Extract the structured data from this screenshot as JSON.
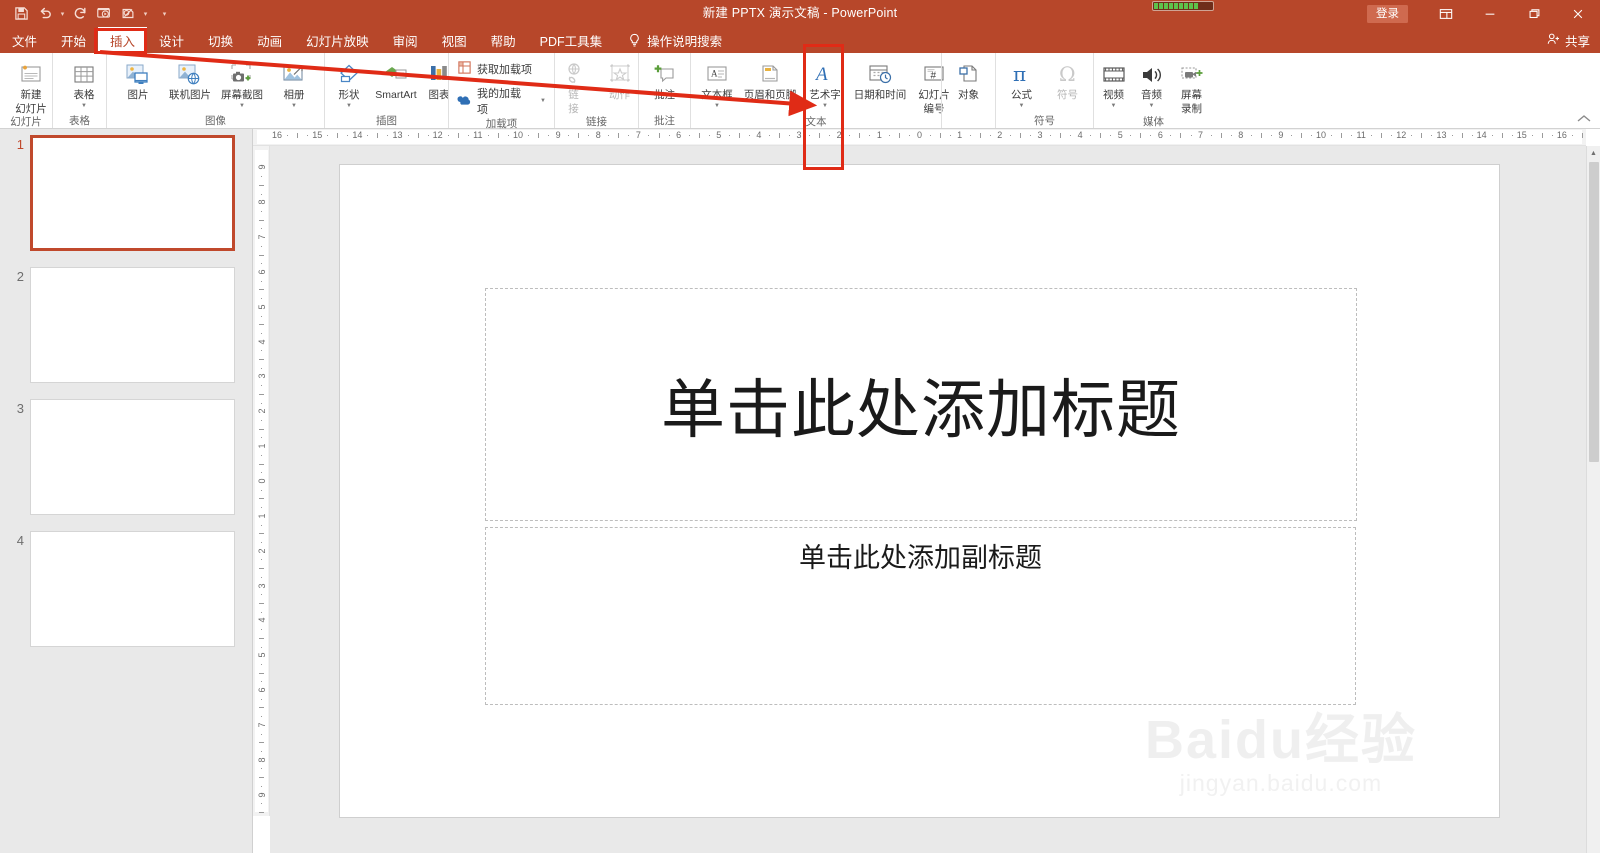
{
  "window": {
    "title": "新建 PPTX 演示文稿  -  PowerPoint",
    "signin_label": "登录",
    "share_label": "共享",
    "accent_color": "#b7472a",
    "annotation_color": "#e02b16"
  },
  "quick_access": [
    {
      "name": "save-icon",
      "label": "保存"
    },
    {
      "name": "undo-icon",
      "label": "撤消"
    },
    {
      "name": "redo-icon",
      "label": "恢复"
    },
    {
      "name": "start-slideshow-icon",
      "label": "从头开始"
    },
    {
      "name": "touch-mouse-mode-icon",
      "label": "触摸/鼠标模式"
    },
    {
      "name": "customize-qat-icon",
      "label": "自定义快速访问工具栏"
    }
  ],
  "window_buttons": [
    {
      "name": "ribbon-display-options-icon",
      "label": "功能区显示选项"
    },
    {
      "name": "minimize-icon",
      "label": "最小化"
    },
    {
      "name": "restore-icon",
      "label": "向下还原"
    },
    {
      "name": "close-icon",
      "label": "关闭"
    }
  ],
  "tabs": [
    {
      "label": "文件",
      "active": false
    },
    {
      "label": "开始",
      "active": false
    },
    {
      "label": "插入",
      "active": true
    },
    {
      "label": "设计",
      "active": false
    },
    {
      "label": "切换",
      "active": false
    },
    {
      "label": "动画",
      "active": false
    },
    {
      "label": "幻灯片放映",
      "active": false
    },
    {
      "label": "审阅",
      "active": false
    },
    {
      "label": "视图",
      "active": false
    },
    {
      "label": "帮助",
      "active": false
    },
    {
      "label": "PDF工具集",
      "active": false
    }
  ],
  "tell_me": {
    "label": "操作说明搜索",
    "icon": "lightbulb-icon"
  },
  "ribbon": {
    "groups": [
      {
        "name": "slides",
        "label": "幻灯片",
        "buttons": [
          {
            "name": "new-slide-button",
            "label": "新建\n幻灯片",
            "line1": "新建",
            "line2": "幻灯片",
            "dropdown": true,
            "disabled": false
          }
        ]
      },
      {
        "name": "tables",
        "label": "表格",
        "buttons": [
          {
            "name": "table-button",
            "line1": "表格",
            "line2": "",
            "dropdown": true,
            "disabled": false
          }
        ]
      },
      {
        "name": "images",
        "label": "图像",
        "buttons": [
          {
            "name": "pictures-button",
            "line1": "图片",
            "line2": "",
            "dropdown": false,
            "disabled": false
          },
          {
            "name": "online-pictures-button",
            "line1": "联机图片",
            "line2": "",
            "dropdown": false,
            "disabled": false
          },
          {
            "name": "screenshot-button",
            "line1": "屏幕截图",
            "line2": "",
            "dropdown": true,
            "disabled": false
          },
          {
            "name": "photo-album-button",
            "line1": "相册",
            "line2": "",
            "dropdown": true,
            "disabled": false
          }
        ]
      },
      {
        "name": "illustrations",
        "label": "插图",
        "buttons": [
          {
            "name": "shapes-button",
            "line1": "形状",
            "line2": "",
            "dropdown": true,
            "disabled": false
          },
          {
            "name": "smartart-button",
            "line1": "SmartArt",
            "line2": "",
            "dropdown": false,
            "disabled": false
          },
          {
            "name": "chart-button",
            "line1": "图表",
            "line2": "",
            "dropdown": false,
            "disabled": false
          }
        ]
      },
      {
        "name": "addins",
        "label": "加载项",
        "small_buttons": [
          {
            "name": "get-addins-button",
            "label": "获取加载项",
            "dropdown": false,
            "disabled": false
          },
          {
            "name": "my-addins-button",
            "label": "我的加载项",
            "dropdown": true,
            "disabled": false
          }
        ]
      },
      {
        "name": "links",
        "label": "链接",
        "buttons": [
          {
            "name": "link-button",
            "line1": "链",
            "line2": "接",
            "dropdown": false,
            "disabled": true
          },
          {
            "name": "action-button",
            "line1": "动作",
            "line2": "",
            "dropdown": false,
            "disabled": true
          }
        ]
      },
      {
        "name": "comments",
        "label": "批注",
        "buttons": [
          {
            "name": "new-comment-button",
            "line1": "批注",
            "line2": "",
            "dropdown": false,
            "disabled": false
          }
        ]
      },
      {
        "name": "text",
        "label": "文本",
        "buttons": [
          {
            "name": "text-box-button",
            "line1": "文本框",
            "line2": "",
            "dropdown": true,
            "disabled": false
          },
          {
            "name": "header-footer-button",
            "line1": "页眉和页脚",
            "line2": "",
            "dropdown": false,
            "disabled": false
          },
          {
            "name": "word-art-button",
            "line1": "艺术字",
            "line2": "",
            "dropdown": true,
            "disabled": false
          },
          {
            "name": "date-time-button",
            "line1": "日期和时间",
            "line2": "",
            "dropdown": false,
            "disabled": false
          },
          {
            "name": "slide-number-button",
            "line1": "幻灯片",
            "line2": "编号",
            "dropdown": false,
            "disabled": false,
            "highlighted": true
          }
        ]
      },
      {
        "name": "object",
        "label": "",
        "buttons": [
          {
            "name": "object-button",
            "line1": "对象",
            "line2": "",
            "dropdown": false,
            "disabled": false
          }
        ]
      },
      {
        "name": "symbols",
        "label": "符号",
        "buttons": [
          {
            "name": "equation-button",
            "line1": "公式",
            "line2": "",
            "dropdown": true,
            "disabled": false
          },
          {
            "name": "symbol-button",
            "line1": "符号",
            "line2": "",
            "dropdown": false,
            "disabled": true
          }
        ]
      },
      {
        "name": "media",
        "label": "媒体",
        "buttons": [
          {
            "name": "video-button",
            "line1": "视频",
            "line2": "",
            "dropdown": true,
            "disabled": false
          },
          {
            "name": "audio-button",
            "line1": "音频",
            "line2": "",
            "dropdown": true,
            "disabled": false
          },
          {
            "name": "screen-recording-button",
            "line1": "屏幕",
            "line2": "录制",
            "dropdown": false,
            "disabled": false
          }
        ]
      }
    ]
  },
  "rulers": {
    "horizontal_ticks": [
      "16",
      "15",
      "14",
      "13",
      "12",
      "11",
      "10",
      "9",
      "8",
      "7",
      "6",
      "5",
      "4",
      "3",
      "2",
      "1",
      "0",
      "1",
      "2",
      "3",
      "4",
      "5",
      "6",
      "7",
      "8",
      "9",
      "10",
      "11",
      "12",
      "13",
      "14",
      "15",
      "16"
    ],
    "vertical_ticks": [
      "9",
      "8",
      "7",
      "6",
      "5",
      "4",
      "3",
      "2",
      "1",
      "0",
      "1",
      "2",
      "3",
      "4",
      "5",
      "6",
      "7",
      "8",
      "9"
    ]
  },
  "thumbnails": [
    {
      "number": "1",
      "selected": true
    },
    {
      "number": "2",
      "selected": false
    },
    {
      "number": "3",
      "selected": false
    },
    {
      "number": "4",
      "selected": false
    }
  ],
  "slide": {
    "title_placeholder": "单击此处添加标题",
    "subtitle_placeholder": "单击此处添加副标题"
  },
  "watermark": {
    "top": "Baidu经验",
    "bottom": "jingyan.baidu.com"
  }
}
